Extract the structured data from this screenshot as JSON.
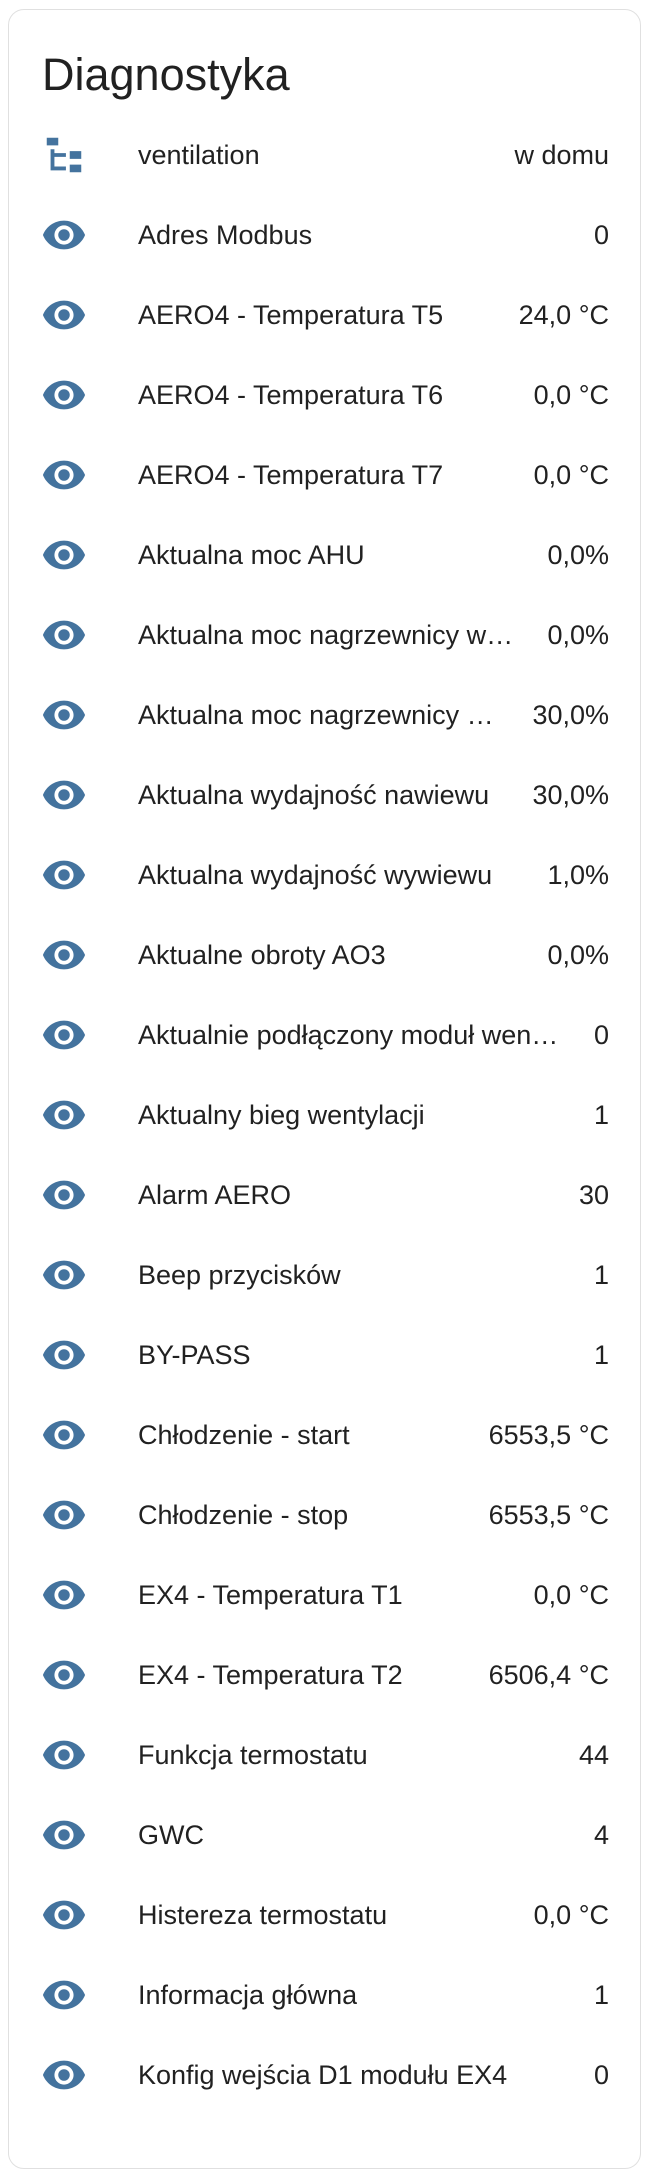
{
  "card": {
    "title": "Diagnostyka"
  },
  "colors": {
    "icon": "#44739e",
    "text": "#212121",
    "border": "#e0e0e0"
  },
  "rows": [
    {
      "icon": "network-icon",
      "label": "ventilation",
      "value": "w domu"
    },
    {
      "icon": "eye-icon",
      "label": "Adres Modbus",
      "value": "0"
    },
    {
      "icon": "eye-icon",
      "label": "AERO4 - Temperatura T5",
      "value": "24,0 °C"
    },
    {
      "icon": "eye-icon",
      "label": "AERO4 - Temperatura T6",
      "value": "0,0 °C"
    },
    {
      "icon": "eye-icon",
      "label": "AERO4 - Temperatura T7",
      "value": "0,0 °C"
    },
    {
      "icon": "eye-icon",
      "label": "Aktualna moc AHU",
      "value": "0,0%"
    },
    {
      "icon": "eye-icon",
      "label": "Aktualna moc nagrzewnicy w…",
      "value": "0,0%"
    },
    {
      "icon": "eye-icon",
      "label": "Aktualna moc nagrzewnicy …",
      "value": "30,0%"
    },
    {
      "icon": "eye-icon",
      "label": "Aktualna wydajność nawiewu",
      "value": "30,0%"
    },
    {
      "icon": "eye-icon",
      "label": "Aktualna wydajność wywiewu",
      "value": "1,0%"
    },
    {
      "icon": "eye-icon",
      "label": "Aktualne obroty AO3",
      "value": "0,0%"
    },
    {
      "icon": "eye-icon",
      "label": "Aktualnie podłączony moduł wen…",
      "value": "0"
    },
    {
      "icon": "eye-icon",
      "label": "Aktualny bieg wentylacji",
      "value": "1"
    },
    {
      "icon": "eye-icon",
      "label": "Alarm AERO",
      "value": "30"
    },
    {
      "icon": "eye-icon",
      "label": "Beep przycisków",
      "value": "1"
    },
    {
      "icon": "eye-icon",
      "label": "BY-PASS",
      "value": "1"
    },
    {
      "icon": "eye-icon",
      "label": "Chłodzenie - start",
      "value": "6553,5 °C"
    },
    {
      "icon": "eye-icon",
      "label": "Chłodzenie - stop",
      "value": "6553,5 °C"
    },
    {
      "icon": "eye-icon",
      "label": "EX4 - Temperatura T1",
      "value": "0,0 °C"
    },
    {
      "icon": "eye-icon",
      "label": "EX4 - Temperatura T2",
      "value": "6506,4 °C"
    },
    {
      "icon": "eye-icon",
      "label": "Funkcja termostatu",
      "value": "44"
    },
    {
      "icon": "eye-icon",
      "label": "GWC",
      "value": "4"
    },
    {
      "icon": "eye-icon",
      "label": "Histereza termostatu",
      "value": "0,0 °C"
    },
    {
      "icon": "eye-icon",
      "label": "Informacja główna",
      "value": "1"
    },
    {
      "icon": "eye-icon",
      "label": "Konfig wejścia D1 modułu EX4",
      "value": "0"
    }
  ]
}
